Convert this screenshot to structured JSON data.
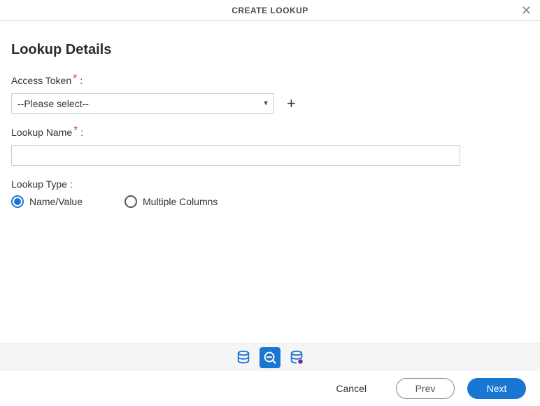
{
  "header": {
    "title": "CREATE LOOKUP"
  },
  "section": {
    "title": "Lookup Details"
  },
  "fields": {
    "access_token": {
      "label": "Access Token",
      "placeholder": "--Please select--",
      "value": "--Please select--"
    },
    "lookup_name": {
      "label": "Lookup Name",
      "value": ""
    },
    "lookup_type": {
      "label": "Lookup Type",
      "options": [
        {
          "label": "Name/Value",
          "checked": true
        },
        {
          "label": "Multiple Columns",
          "checked": false
        }
      ]
    }
  },
  "footer": {
    "cancel": "Cancel",
    "prev": "Prev",
    "next": "Next"
  }
}
